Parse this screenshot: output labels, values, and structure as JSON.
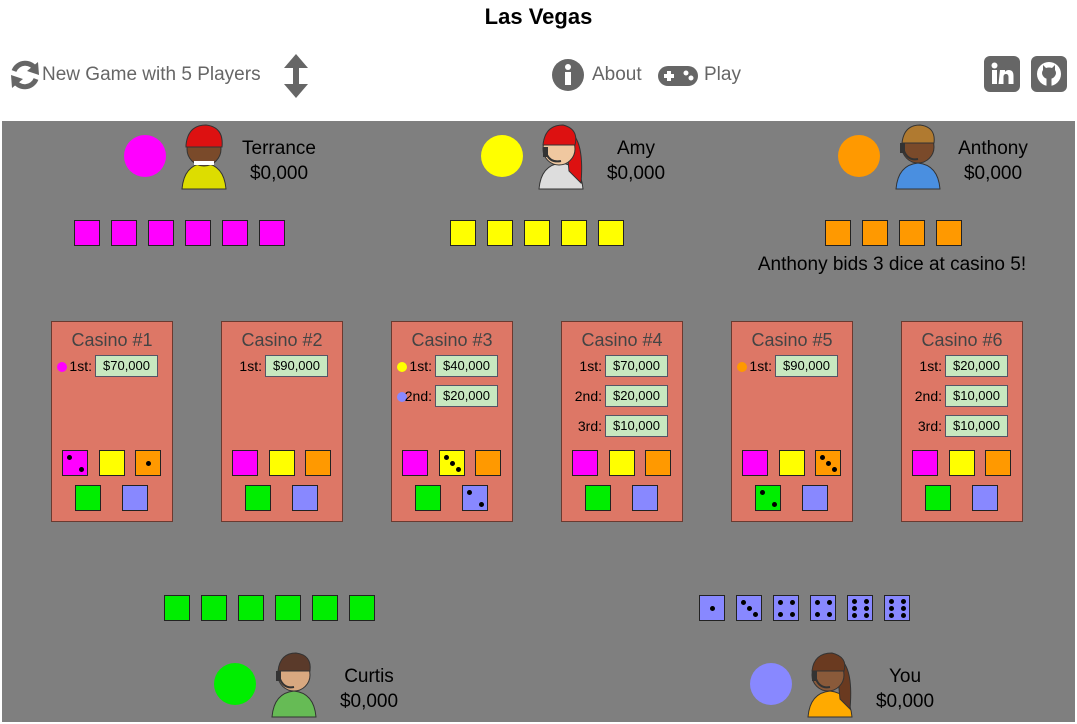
{
  "title": "Las Vegas",
  "toolbar": {
    "new_game_label": "New Game with 5 Players",
    "about_label": "About",
    "play_label": "Play"
  },
  "colors": {
    "board": "#7f7f7f",
    "casino": "#dd7766",
    "magenta": "#ff00ff",
    "yellow": "#ffff00",
    "orange": "#ff9900",
    "green": "#00ee00",
    "blue": "#8888ff"
  },
  "players": [
    {
      "name": "Terrance",
      "money": "$0,000",
      "color": "#ff00ff",
      "dice_count": 6,
      "avatar": "red-helmet-yellow-shirt-avatar-icon"
    },
    {
      "name": "Amy",
      "money": "$0,000",
      "color": "#ffff00",
      "dice_count": 5,
      "avatar": "red-hair-headset-avatar-icon"
    },
    {
      "name": "Anthony",
      "money": "$0,000",
      "color": "#ff9900",
      "dice_count": 4,
      "avatar": "headset-blue-shirt-avatar-icon"
    },
    {
      "name": "Curtis",
      "money": "$0,000",
      "color": "#00ee00",
      "dice_count": 6,
      "avatar": "headset-green-shirt-avatar-icon"
    },
    {
      "name": "You",
      "money": "$0,000",
      "color": "#8888ff",
      "dice_values": [
        1,
        3,
        4,
        4,
        6,
        6
      ],
      "avatar": "headset-orange-shirt-avatar-icon"
    }
  ],
  "message": "Anthony bids 3 dice at casino 5!",
  "casinos": [
    {
      "title": "Casino #1",
      "prizes": [
        {
          "rank": "1st:",
          "amount": "$70,000",
          "leader_color": "#ff00ff"
        }
      ],
      "bids": [
        2,
        0,
        1,
        0,
        0
      ]
    },
    {
      "title": "Casino #2",
      "prizes": [
        {
          "rank": "1st:",
          "amount": "$90,000",
          "leader_color": null
        }
      ],
      "bids": [
        0,
        0,
        0,
        0,
        0
      ]
    },
    {
      "title": "Casino #3",
      "prizes": [
        {
          "rank": "1st:",
          "amount": "$40,000",
          "leader_color": "#ffff00"
        },
        {
          "rank": "2nd:",
          "amount": "$20,000",
          "leader_color": "#8888ff"
        }
      ],
      "bids": [
        0,
        3,
        0,
        0,
        2
      ]
    },
    {
      "title": "Casino #4",
      "prizes": [
        {
          "rank": "1st:",
          "amount": "$70,000",
          "leader_color": null
        },
        {
          "rank": "2nd:",
          "amount": "$20,000",
          "leader_color": null
        },
        {
          "rank": "3rd:",
          "amount": "$10,000",
          "leader_color": null
        }
      ],
      "bids": [
        0,
        0,
        0,
        0,
        0
      ]
    },
    {
      "title": "Casino #5",
      "prizes": [
        {
          "rank": "1st:",
          "amount": "$90,000",
          "leader_color": "#ff9900"
        }
      ],
      "bids": [
        0,
        0,
        3,
        2,
        0
      ]
    },
    {
      "title": "Casino #6",
      "prizes": [
        {
          "rank": "1st:",
          "amount": "$20,000",
          "leader_color": null
        },
        {
          "rank": "2nd:",
          "amount": "$10,000",
          "leader_color": null
        },
        {
          "rank": "3rd:",
          "amount": "$10,000",
          "leader_color": null
        }
      ],
      "bids": [
        0,
        0,
        0,
        0,
        0
      ]
    }
  ]
}
